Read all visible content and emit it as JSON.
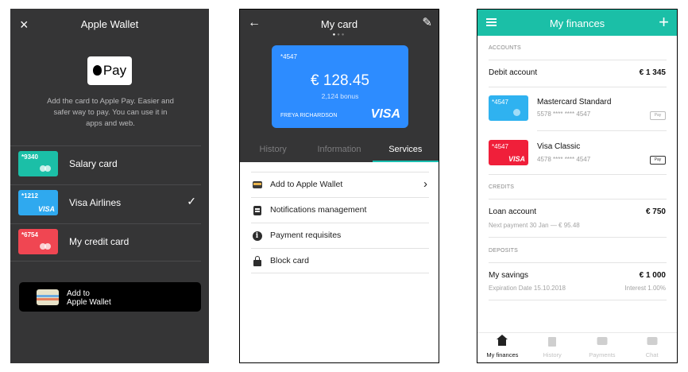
{
  "screen1": {
    "close_icon": "×",
    "title": "Apple Wallet",
    "pay_badge_text": "Pay",
    "description": "Add the card to Apple Pay. Easier and safer way to pay. You can use it in apps and web.",
    "cards": [
      {
        "number": "*9340",
        "label": "Salary card",
        "color": "#1bbfa7",
        "brand": "mastercard",
        "selected": false
      },
      {
        "number": "*1212",
        "label": "Visa Airlines",
        "color": "#2fa9ef",
        "brand": "VISA",
        "selected": true
      },
      {
        "number": "*6754",
        "label": "My credit card",
        "color": "#f04652",
        "brand": "mastercard",
        "selected": false
      }
    ],
    "check_icon": "✓",
    "add_button_line1": "Add to",
    "add_button_line2": "Apple Wallet"
  },
  "screen2": {
    "back_icon": "←",
    "title": "My card",
    "edit_icon": "✎",
    "card": {
      "number": "*4547",
      "amount": "€ 128.45",
      "bonus": "2,124 bonus",
      "holder": "FREYA RICHARDSON",
      "brand": "VISA",
      "color": "#2d8cff"
    },
    "tabs": [
      {
        "label": "History",
        "active": false
      },
      {
        "label": "Information",
        "active": false
      },
      {
        "label": "Services",
        "active": true
      }
    ],
    "services": [
      {
        "label": "Add to Apple Wallet",
        "icon": "wallet-icon",
        "chevron": true
      },
      {
        "label": "Notifications management",
        "icon": "notifications-icon",
        "chevron": false
      },
      {
        "label": "Payment requisites",
        "icon": "info-icon",
        "chevron": false
      },
      {
        "label": "Block card",
        "icon": "lock-icon",
        "chevron": false
      }
    ],
    "accent": "#1bbfb0"
  },
  "screen3": {
    "title": "My finances",
    "plus_icon": "+",
    "accent": "#1bbfa7",
    "accounts_label": "ACCOUNTS",
    "debit": {
      "name": "Debit account",
      "value": "€ 1 345"
    },
    "cards": [
      {
        "number": "*4547",
        "name": "Mastercard Standard",
        "masked": "5578 **** **** 4547",
        "color": "#2fb2f0",
        "brand": "mastercard",
        "apple_pay": false
      },
      {
        "number": "*4547",
        "name": "Visa Classic",
        "masked": "4578 **** **** 4547",
        "color": "#f01f3a",
        "brand": "VISA",
        "apple_pay": true
      }
    ],
    "pay_badge": "Pay",
    "credits_label": "CREDITS",
    "loan": {
      "name": "Loan account",
      "value": "€ 750",
      "next_payment": "Next payment 30 Jan — € 95.48"
    },
    "deposits_label": "DEPOSITS",
    "savings": {
      "name": "My savings",
      "value": "€ 1 000",
      "expiration": "Expiration Date  15.10.2018",
      "interest": "Interest 1.00%"
    },
    "nav": [
      {
        "label": "My finances",
        "active": true
      },
      {
        "label": "History",
        "active": false
      },
      {
        "label": "Payments",
        "active": false
      },
      {
        "label": "Chat",
        "active": false
      }
    ]
  }
}
